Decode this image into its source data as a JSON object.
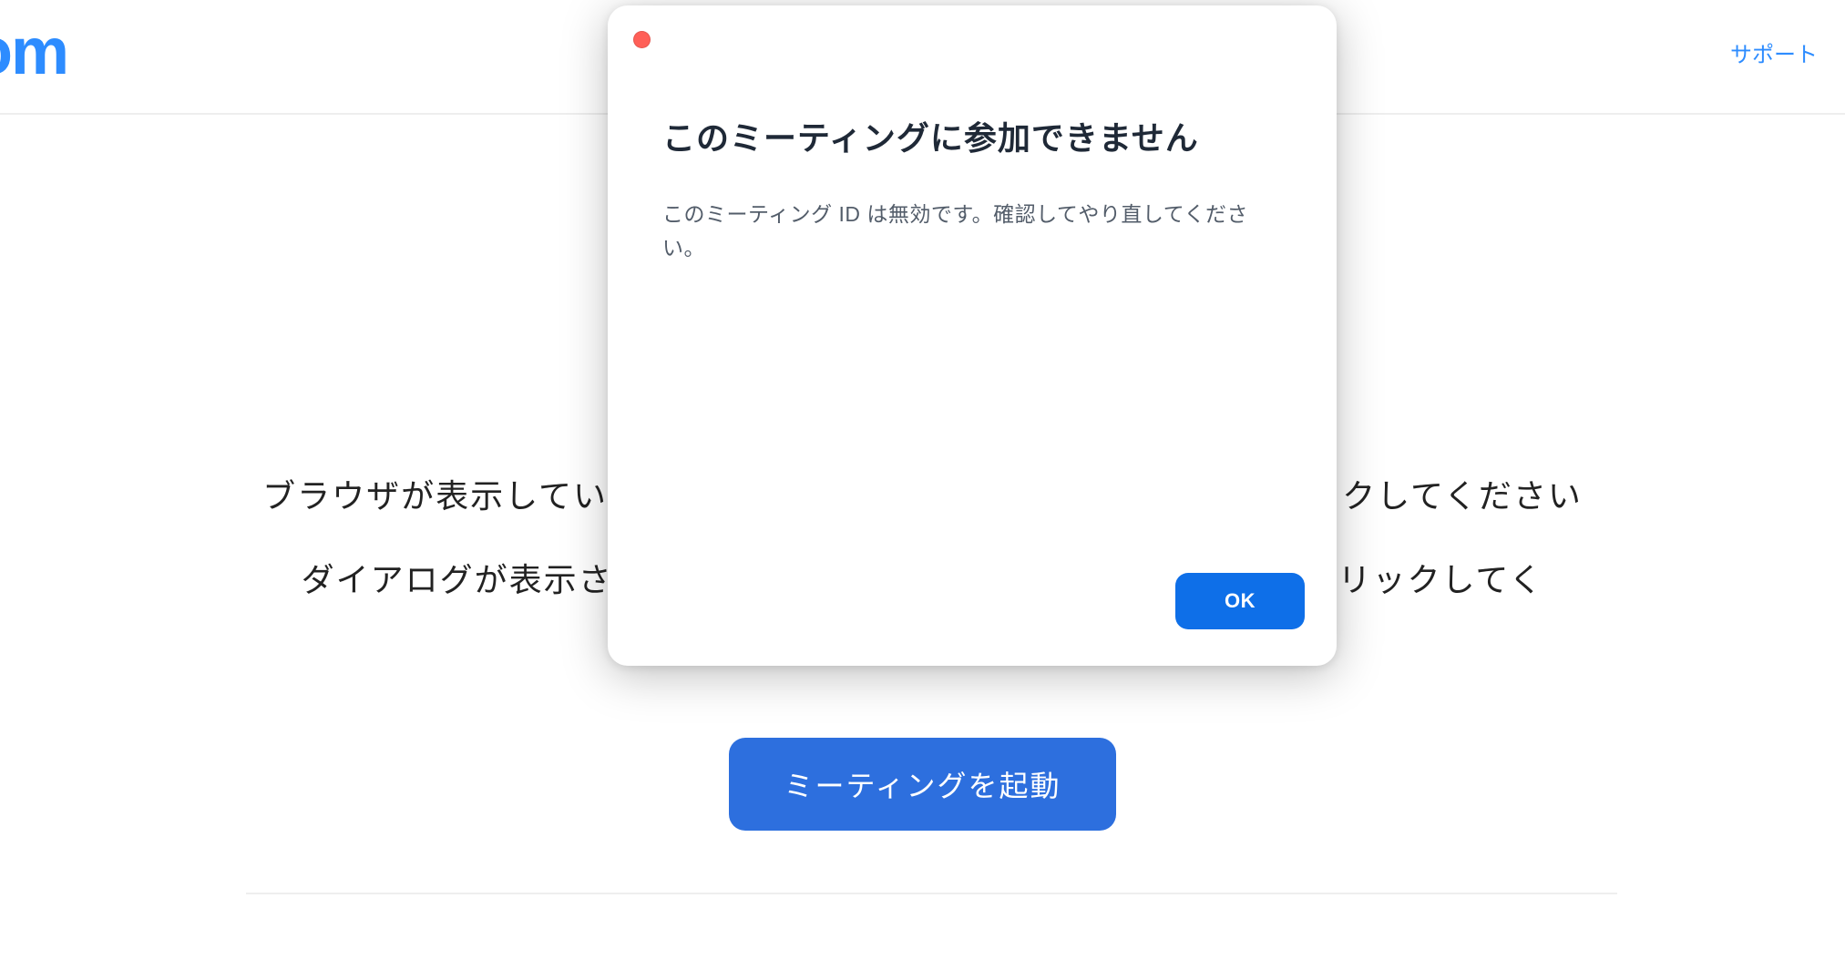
{
  "header": {
    "logo_fragment": "om",
    "support_label": "サポート"
  },
  "main": {
    "instruction_line_1": "ブラウザが表示しているダイアログのZoom Meetingsを開くをクリックしてください",
    "instruction_line_2": "ダイアログが表示されない場合は、以下のミーティングを起動をクリックしてく",
    "launch_button_label": "ミーティングを起動"
  },
  "modal": {
    "title": "このミーティングに参加できません",
    "body": "このミーティング ID は無効です。確認してやり直してください。",
    "ok_label": "OK"
  }
}
